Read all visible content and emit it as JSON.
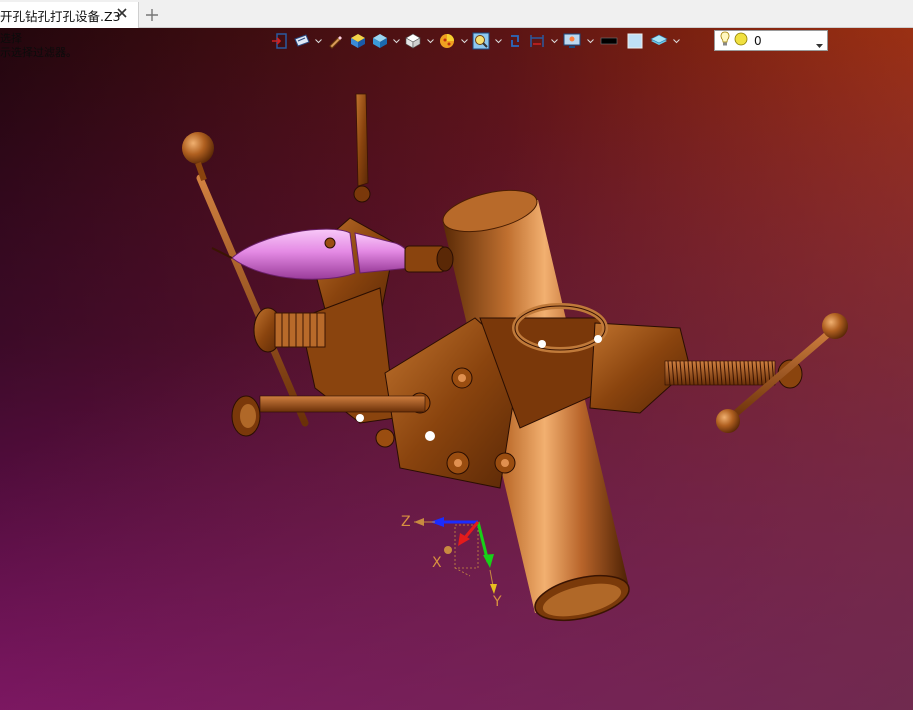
{
  "tab": {
    "title": "开孔钻孔打孔设备.Z3"
  },
  "prompt": {
    "line1": "选择",
    "line2": "示选择过滤器。"
  },
  "toolbar": {
    "items": [
      {
        "icon": "exit-sketch-icon"
      },
      {
        "icon": "view-orient-icon"
      },
      {
        "icon": "pencil-icon"
      },
      {
        "icon": "render-mode-icon"
      },
      {
        "icon": "shaded-cube-icon"
      },
      {
        "icon": "white-cube-icon"
      },
      {
        "icon": "display-filter-icon"
      },
      {
        "icon": "zoom-fit-icon"
      },
      {
        "icon": "rotate-icon"
      },
      {
        "icon": "dimension-icon"
      },
      {
        "icon": "screen-capture-icon"
      },
      {
        "icon": "black-color-swatch-icon"
      },
      {
        "icon": "light-color-swatch-icon"
      },
      {
        "icon": "layer-stack-icon"
      }
    ],
    "layer_value": "0"
  },
  "triad": {
    "x": "X",
    "y": "Y",
    "z": "Z"
  },
  "colors": {
    "part_copper": "#9a4d10",
    "highlight": "#ee99ee",
    "bg_top_left": "#1a0508",
    "bg_top_right": "#9e2c08",
    "bg_bottom_left": "#7a1066",
    "bg_bottom_right": "#6a2038"
  }
}
